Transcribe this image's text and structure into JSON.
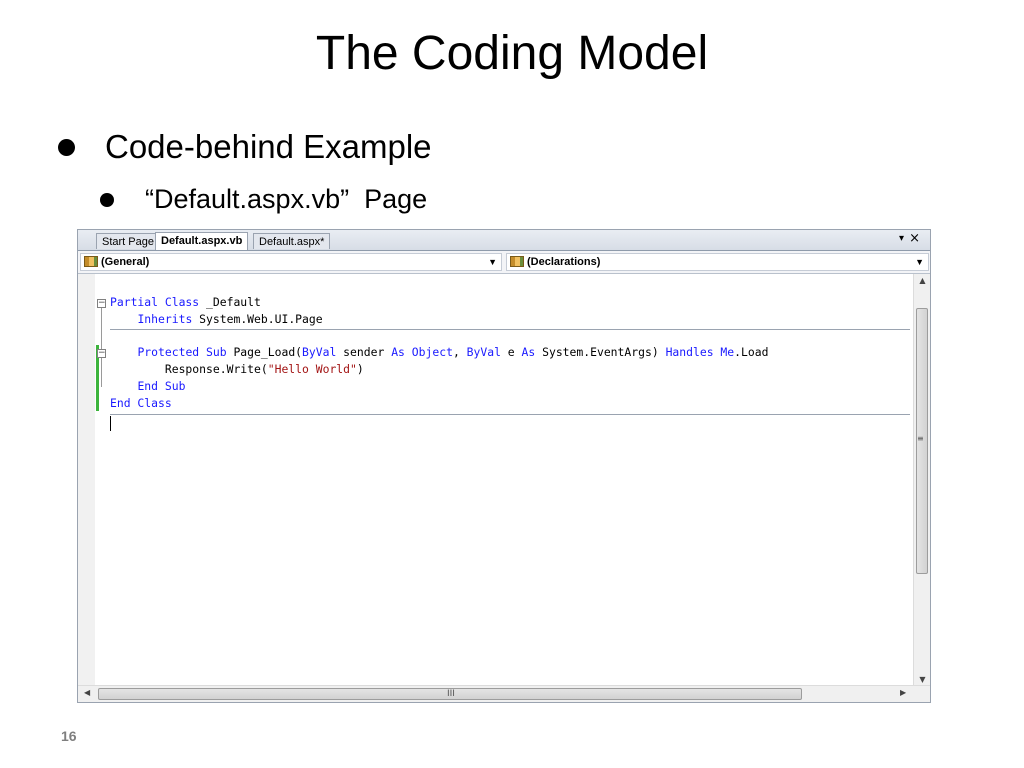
{
  "slide": {
    "title": "The Coding Model",
    "bullet1": "Code-behind Example",
    "bullet2": "“Default.aspx.vb”  Page",
    "page_number": "16"
  },
  "ide": {
    "tabs": [
      {
        "label": "Start Page",
        "active": false
      },
      {
        "label": "Default.aspx.vb",
        "active": true
      },
      {
        "label": "Default.aspx*",
        "active": false
      }
    ],
    "tab_menu": "▾",
    "tab_close": "×",
    "nav": {
      "left_combo": "(General)",
      "right_combo": "(Declarations)"
    },
    "code_lines": [
      [
        {
          "t": "Partial Class",
          "k": "kw"
        },
        {
          "t": " _Default",
          "k": ""
        }
      ],
      [
        {
          "t": "    ",
          "k": ""
        },
        {
          "t": "Inherits",
          "k": "kw"
        },
        {
          "t": " System.Web.UI.Page",
          "k": ""
        }
      ],
      [],
      [
        {
          "t": "    ",
          "k": ""
        },
        {
          "t": "Protected Sub",
          "k": "kw"
        },
        {
          "t": " Page_Load(",
          "k": ""
        },
        {
          "t": "ByVal",
          "k": "kw"
        },
        {
          "t": " sender ",
          "k": ""
        },
        {
          "t": "As Object",
          "k": "kw"
        },
        {
          "t": ", ",
          "k": ""
        },
        {
          "t": "ByVal",
          "k": "kw"
        },
        {
          "t": " e ",
          "k": ""
        },
        {
          "t": "As",
          "k": "kw"
        },
        {
          "t": " System.EventArgs) ",
          "k": ""
        },
        {
          "t": "Handles Me",
          "k": "kw"
        },
        {
          "t": ".Load",
          "k": ""
        }
      ],
      [
        {
          "t": "        Response.Write(",
          "k": ""
        },
        {
          "t": "\"Hello World\"",
          "k": "str"
        },
        {
          "t": ")",
          "k": ""
        }
      ],
      [
        {
          "t": "    ",
          "k": ""
        },
        {
          "t": "End Sub",
          "k": "kw"
        }
      ],
      [
        {
          "t": "End Class",
          "k": "kw"
        }
      ]
    ],
    "colors": {
      "keyword": "#1a1aff",
      "string": "#a31515",
      "change_bar": "#3cb43c"
    }
  }
}
